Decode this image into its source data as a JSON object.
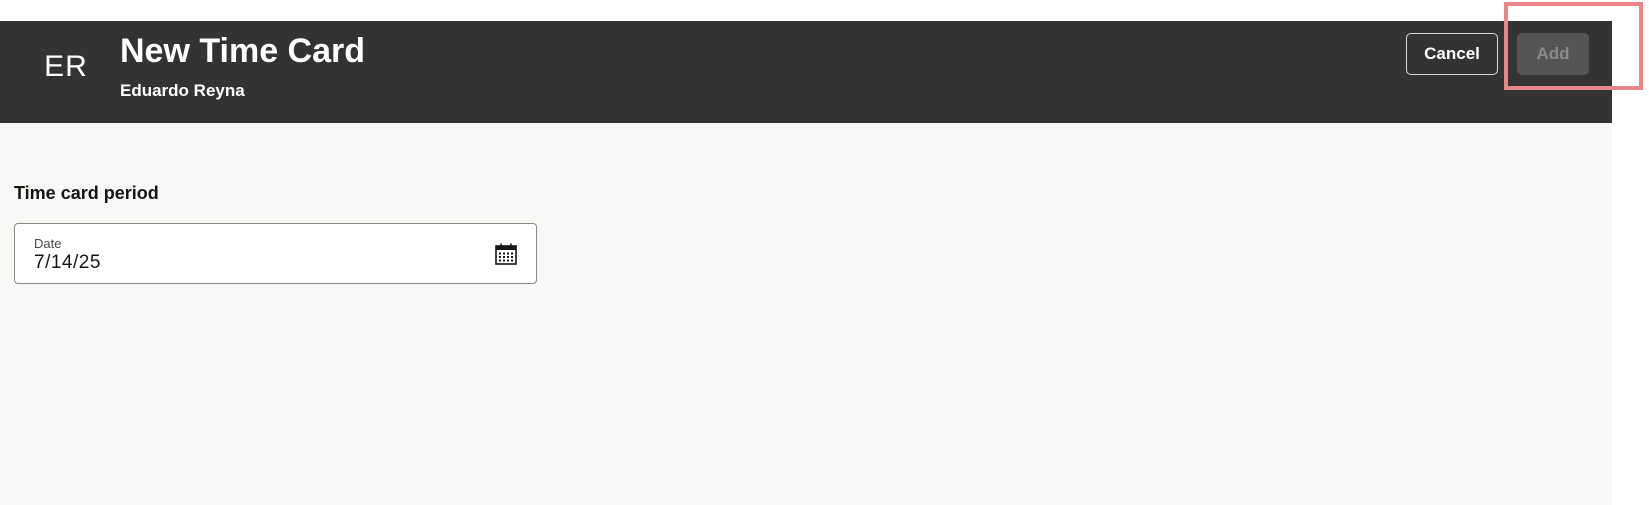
{
  "header": {
    "avatar_initials": "ER",
    "title": "New Time Card",
    "subtitle": "Eduardo Reyna",
    "cancel_label": "Cancel",
    "add_label": "Add"
  },
  "main": {
    "section_label": "Time card period",
    "date_field": {
      "label": "Date",
      "value": "7/14/25",
      "icon": "calendar-icon"
    }
  },
  "colors": {
    "header_bg": "#333333",
    "content_bg": "#f9f8f6",
    "add_button_disabled_bg": "#555555",
    "highlight": "#e8868a"
  }
}
